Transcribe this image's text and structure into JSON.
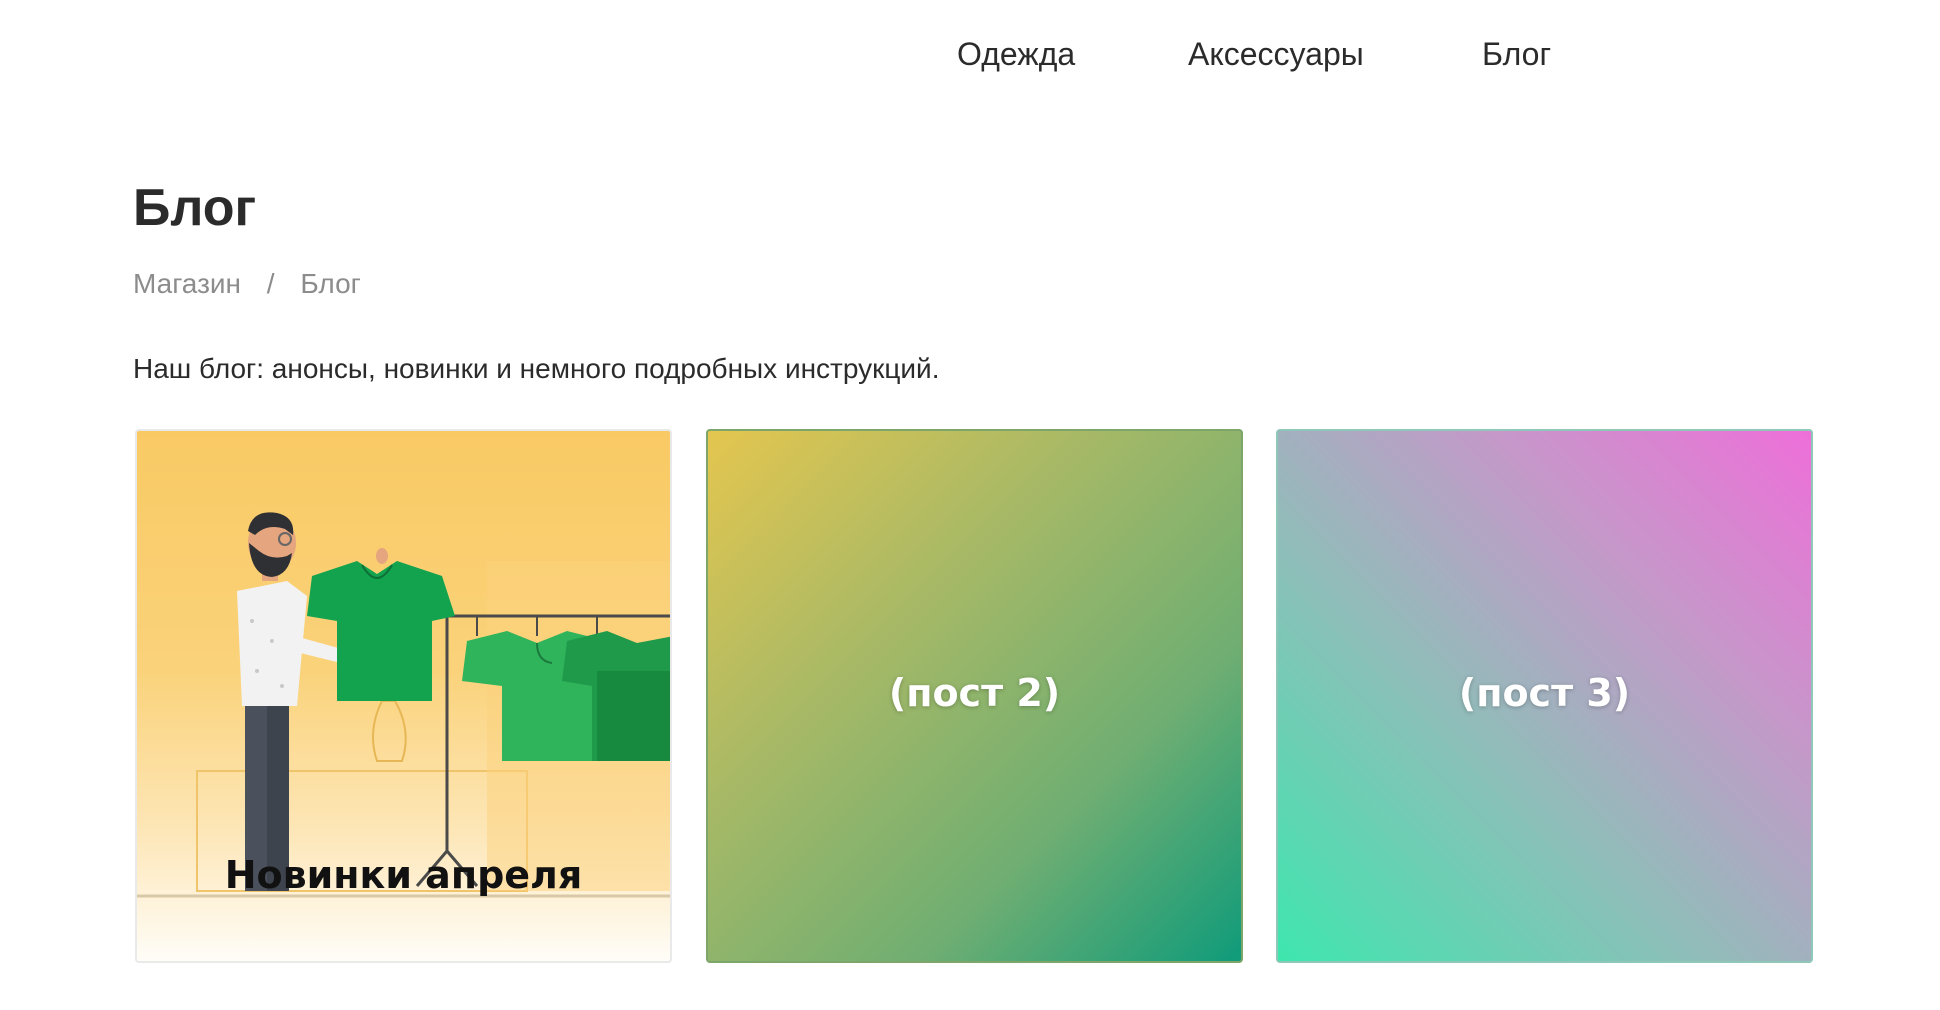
{
  "nav": {
    "items": [
      {
        "label": "Одежда"
      },
      {
        "label": "Аксессуары"
      },
      {
        "label": "Блог"
      }
    ]
  },
  "page": {
    "title": "Блог",
    "breadcrumb": [
      {
        "label": "Магазин"
      },
      {
        "label": "Блог"
      }
    ],
    "breadcrumb_separator": "/",
    "description": "Наш блог: анонсы, новинки и немного подробных инструкций."
  },
  "posts": [
    {
      "title": "Новинки апреля",
      "image": "man-with-tshirts-illustration"
    },
    {
      "title": "(пост 2)",
      "gradient": [
        "#e4c64f",
        "#0f9b7a"
      ]
    },
    {
      "title": "(пост 3)",
      "gradient": [
        "#3ee6ae",
        "#ee6fd9"
      ]
    }
  ]
}
